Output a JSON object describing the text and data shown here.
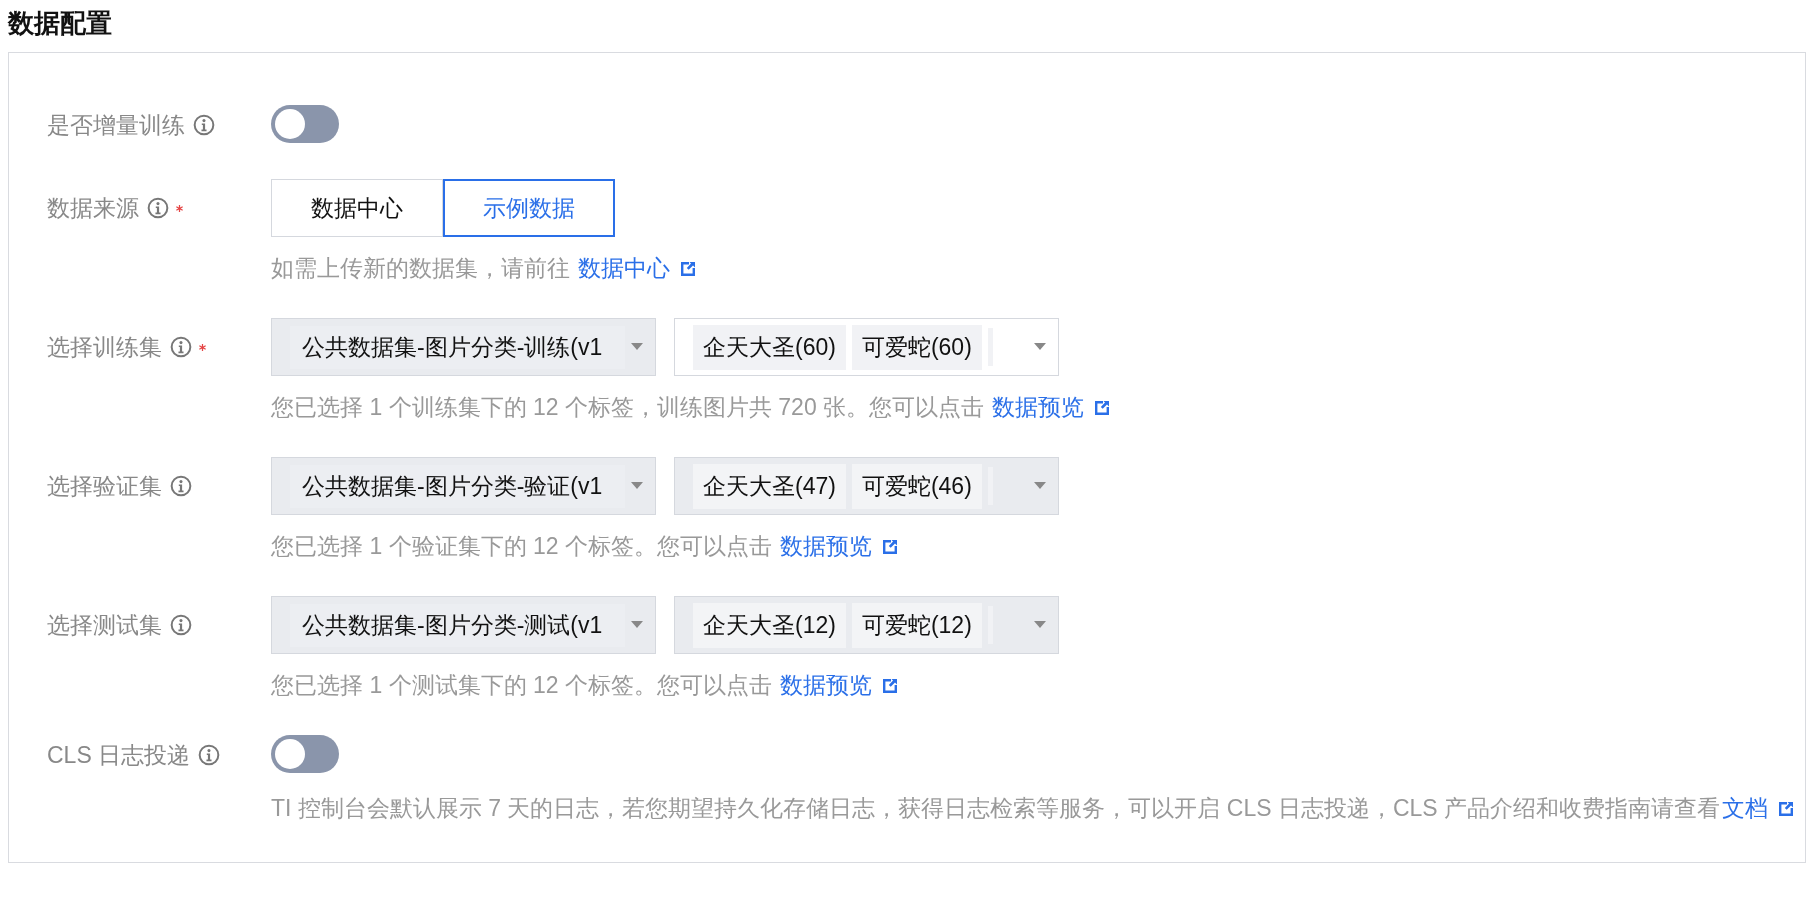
{
  "title": "数据配置",
  "fields": [
    {
      "kind": "switch",
      "label": "是否增量训练",
      "required": false,
      "on": false
    },
    {
      "kind": "segmented",
      "label": "数据来源",
      "required": true,
      "options": [
        {
          "label": "数据中心",
          "selected": false
        },
        {
          "label": "示例数据",
          "selected": true
        }
      ],
      "hint": {
        "text": "如需上传新的数据集，请前往 ",
        "link": "数据中心"
      }
    },
    {
      "kind": "dataset",
      "label": "选择训练集",
      "required": true,
      "dataset": {
        "value": "公共数据集-图片分类-训练(v1",
        "disabled": true
      },
      "tags": {
        "items": [
          "企天大圣(60)",
          "可爱蛇(60)"
        ],
        "disabled": false
      },
      "hint": {
        "text": "您已选择 1 个训练集下的 12 个标签，训练图片共 720 张。您可以点击 ",
        "link": "数据预览"
      }
    },
    {
      "kind": "dataset",
      "label": "选择验证集",
      "required": false,
      "dataset": {
        "value": "公共数据集-图片分类-验证(v1",
        "disabled": true
      },
      "tags": {
        "items": [
          "企天大圣(47)",
          "可爱蛇(46)"
        ],
        "disabled": true
      },
      "hint": {
        "text": "您已选择 1 个验证集下的 12 个标签。您可以点击 ",
        "link": "数据预览"
      }
    },
    {
      "kind": "dataset",
      "label": "选择测试集",
      "required": false,
      "dataset": {
        "value": "公共数据集-图片分类-测试(v1",
        "disabled": true
      },
      "tags": {
        "items": [
          "企天大圣(12)",
          "可爱蛇(12)"
        ],
        "disabled": true
      },
      "hint": {
        "text": "您已选择 1 个测试集下的 12 个标签。您可以点击 ",
        "link": "数据预览"
      }
    },
    {
      "kind": "switch",
      "label": "CLS 日志投递",
      "required": false,
      "on": false,
      "hint": {
        "text": "TI 控制台会默认展示 7 天的日志，若您期望持久化存储日志，获得日志检索等服务，可以开启 CLS 日志投递，CLS 产品介绍和收费指南请查看",
        "link": "文档"
      }
    }
  ]
}
